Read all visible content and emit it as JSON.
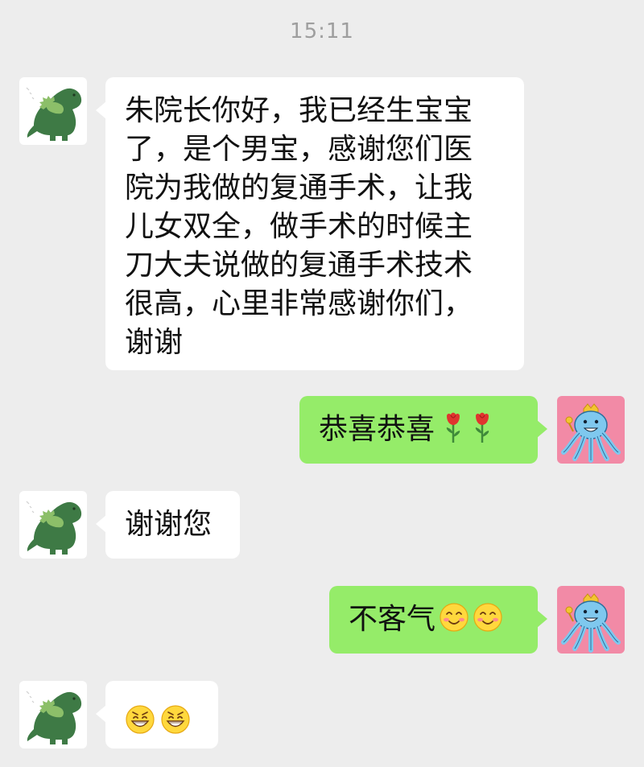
{
  "status": {
    "time": "15:11"
  },
  "conversation": {
    "contact_avatar_icon": "green-dinosaur-avatar",
    "self_avatar_icon": "blue-octopus-with-crown-avatar",
    "messages": [
      {
        "sender": "contact",
        "lines": [
          "朱院长你好，我已经生宝宝",
          "了，是个男宝，感谢您们医",
          "院为我做的复通手术，让我",
          "儿女双全，做手术的时候主",
          "刀大夫说做的复通手术技术",
          "很高，心里非常感谢你们，",
          "谢谢"
        ]
      },
      {
        "sender": "self",
        "text": "恭喜恭喜",
        "emoji": [
          "rose-icon",
          "rose-icon"
        ]
      },
      {
        "sender": "contact",
        "text": "谢谢您"
      },
      {
        "sender": "self",
        "text": "不客气",
        "emoji": [
          "blush-smile-icon",
          "blush-smile-icon"
        ]
      },
      {
        "sender": "contact",
        "text": "",
        "emoji": [
          "grin-icon",
          "grin-icon"
        ]
      }
    ]
  },
  "colors": {
    "background": "#ededed",
    "incoming_bubble": "#ffffff",
    "outgoing_bubble": "#95ec69",
    "self_avatar_bg": "#f28aa6"
  }
}
